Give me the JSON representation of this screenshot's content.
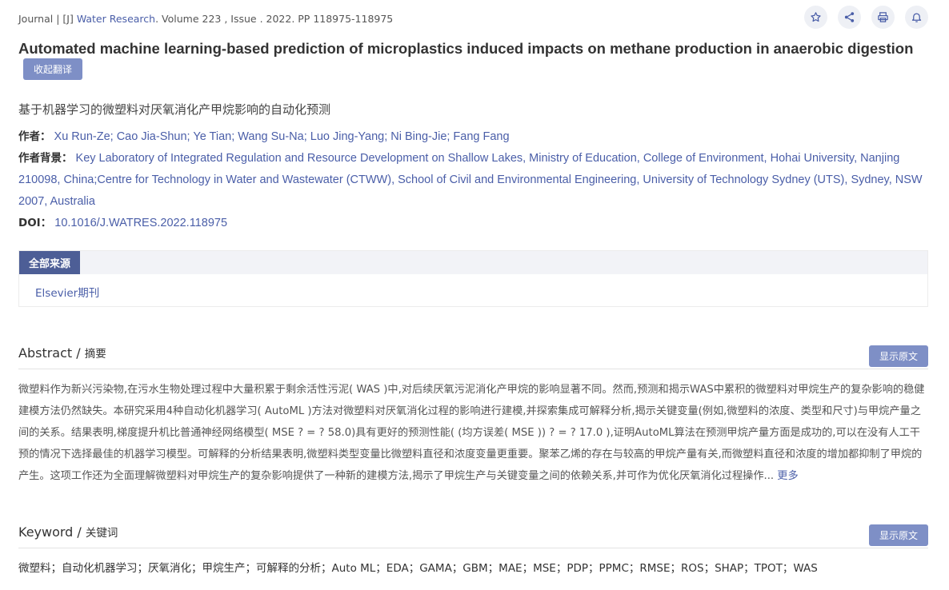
{
  "journal": {
    "prefix": "Journal | [J] ",
    "name": "Water Research",
    "suffix": ". Volume 223 , Issue . 2022. PP 118975-118975"
  },
  "actions": {
    "favorite_icon": "star-icon",
    "share_icon": "share-icon",
    "print_icon": "printer-icon",
    "alert_icon": "bell-icon"
  },
  "article": {
    "title_en": "Automated machine learning-based prediction of microplastics induced impacts on methane production in anaerobic digestion",
    "collapse_label": "收起翻译",
    "title_zh": "基于机器学习的微塑料对厌氧消化产甲烷影响的自动化预测"
  },
  "meta": {
    "authors_label": "作者：",
    "authors": "Xu Run-Ze; Cao Jia-Shun; Ye Tian; Wang Su-Na; Luo Jing-Yang; Ni Bing-Jie; Fang Fang",
    "background_label": "作者背景：",
    "background": "Key Laboratory of Integrated Regulation and Resource Development on Shallow Lakes, Ministry of Education, College of Environment, Hohai University, Nanjing 210098, China;Centre for Technology in Water and Wastewater (CTWW), School of Civil and Environmental Engineering, University of Technology Sydney (UTS), Sydney, NSW 2007, Australia",
    "doi_label": "DOI：",
    "doi": "10.1016/J.WATRES.2022.118975"
  },
  "sources": {
    "tab_label": "全部来源",
    "items": [
      "Elsevier期刊"
    ]
  },
  "abstract": {
    "title_en": "Abstract",
    "sep": " / ",
    "title_zh": "摘要",
    "show_original": "显示原文",
    "text": "微塑料作为新兴污染物,在污水生物处理过程中大量积累于剩余活性污泥( WAS )中,对后续厌氧污泥消化产甲烷的影响显著不同。然而,预测和揭示WAS中累积的微塑料对甲烷生产的复杂影响的稳健建模方法仍然缺失。本研究采用4种自动化机器学习( AutoML )方法对微塑料对厌氧消化过程的影响进行建模,并探索集成可解释分析,揭示关键变量(例如,微塑料的浓度、类型和尺寸)与甲烷产量之间的关系。结果表明,梯度提升机比普通神经网络模型( MSE ? = ? 58.0)具有更好的预测性能( (均方误差( MSE )) ? = ? 17.0 ),证明AutoML算法在预测甲烷产量方面是成功的,可以在没有人工干预的情况下选择最佳的机器学习模型。可解释的分析结果表明,微塑料类型变量比微塑料直径和浓度变量更重要。聚苯乙烯的存在与较高的甲烷产量有关,而微塑料直径和浓度的增加都抑制了甲烷的产生。这项工作还为全面理解微塑料对甲烷生产的复杂影响提供了一种新的建模方法,揭示了甲烷生产与关键变量之间的依赖关系,并可作为优化厌氧消化过程操作...",
    "more": " 更多"
  },
  "keywords": {
    "title_en": "Keyword",
    "sep": " / ",
    "title_zh": "关键词",
    "show_original": "显示原文",
    "list": "微塑料；自动化机器学习；厌氧消化；甲烷生产；可解释的分析；Auto ML；EDA；GAMA；GBM；MAE；MSE；PDP；PPMC；RMSE；ROS；SHAP；TPOT；WAS"
  }
}
